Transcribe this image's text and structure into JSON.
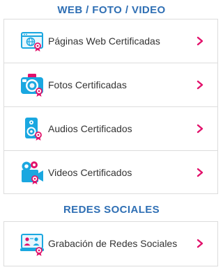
{
  "sections": [
    {
      "title": "WEB / FOTO / VIDEO",
      "items": [
        {
          "label": "Páginas Web Certificadas",
          "icon": "web-page-certified-icon"
        },
        {
          "label": "Fotos Certificadas",
          "icon": "camera-certified-icon"
        },
        {
          "label": "Audios Certificados",
          "icon": "speaker-certified-icon"
        },
        {
          "label": "Videos Certificados",
          "icon": "video-camera-certified-icon"
        }
      ]
    },
    {
      "title": "REDES SOCIALES",
      "items": [
        {
          "label": "Grabación de Redes Sociales",
          "icon": "social-network-recording-icon"
        }
      ]
    }
  ],
  "colors": {
    "title": "#2f6fb4",
    "icon_blue": "#1aa7e0",
    "icon_magenta": "#e2116b",
    "chevron": "#e2116b",
    "border": "#dcdcdc",
    "text": "#333333"
  }
}
